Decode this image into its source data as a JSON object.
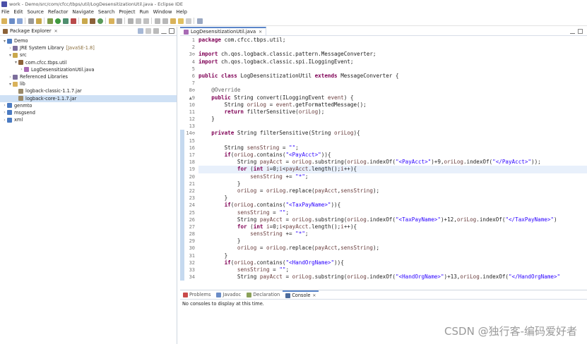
{
  "window": {
    "title": "work - Demo/src/com/cfcc/tbps/util/LogDesensitizationUtil.java - Eclipse IDE"
  },
  "menu": [
    "File",
    "Edit",
    "Source",
    "Refactor",
    "Navigate",
    "Search",
    "Project",
    "Run",
    "Window",
    "Help"
  ],
  "explorer": {
    "tab_label": "Package Explorer",
    "close": "✕",
    "tree": [
      {
        "label": "Demo",
        "indent": 0,
        "arrow": "▾",
        "icon": "project-icon",
        "color": "#4b7bc2"
      },
      {
        "label": "JRE System Library",
        "decor": "[JavaSE-1.8]",
        "indent": 1,
        "arrow": "›",
        "icon": "library-icon",
        "color": "#7c6e9c"
      },
      {
        "label": "src",
        "indent": 1,
        "arrow": "▾",
        "icon": "source-folder-icon",
        "color": "#c9a84c"
      },
      {
        "label": "com.cfcc.tbps.util",
        "indent": 2,
        "arrow": "▾",
        "icon": "package-icon",
        "color": "#8c6239"
      },
      {
        "label": "LogDesensitizationUtil.java",
        "indent": 3,
        "arrow": "›",
        "icon": "java-file-icon",
        "color": "#a86bb5"
      },
      {
        "label": "Referenced Libraries",
        "indent": 1,
        "arrow": "›",
        "icon": "library-icon",
        "color": "#7c6e9c"
      },
      {
        "label": "lib",
        "indent": 1,
        "arrow": "▾",
        "icon": "folder-icon",
        "color": "#d9b25a"
      },
      {
        "label": "logback-classic-1.1.7.jar",
        "indent": 2,
        "arrow": "",
        "icon": "jar-icon",
        "color": "#9a8a6a"
      },
      {
        "label": "logback-core-1.1.7.jar",
        "indent": 2,
        "arrow": "",
        "icon": "jar-icon",
        "color": "#9a8a6a",
        "selected": true
      },
      {
        "label": "genmto",
        "indent": 0,
        "arrow": "›",
        "icon": "project-icon",
        "color": "#4b7bc2"
      },
      {
        "label": "msgsend",
        "indent": 0,
        "arrow": "›",
        "icon": "project-icon",
        "color": "#4b7bc2"
      },
      {
        "label": "xml",
        "indent": 0,
        "arrow": "›",
        "icon": "project-icon",
        "color": "#4b7bc2"
      }
    ]
  },
  "editor": {
    "tab_label": "LogDesensitizationUtil.java",
    "close": "✕",
    "lines": [
      {
        "n": "1",
        "html": "<span class=\"kw\">package</span> com.cfcc.tbps.util;"
      },
      {
        "n": "2",
        "html": ""
      },
      {
        "n": "3⊖",
        "html": "<span class=\"kw\">import</span> ch.qos.logback.classic.pattern.MessageConverter;"
      },
      {
        "n": "4",
        "html": "<span class=\"kw\">import</span> ch.qos.logback.classic.spi.ILoggingEvent;"
      },
      {
        "n": "5",
        "html": ""
      },
      {
        "n": "6",
        "html": "<span class=\"kw\">public class</span> LogDesensitizationUtil <span class=\"kw\">extends</span> MessageConverter {"
      },
      {
        "n": "7",
        "html": ""
      },
      {
        "n": "8⊖",
        "html": "    <span class=\"ann\">@Override</span>"
      },
      {
        "n": "▲9",
        "html": "    <span class=\"kw\">public</span> String convert(ILoggingEvent <span class=\"var\">event</span>) {"
      },
      {
        "n": "10",
        "html": "        String <span class=\"var\">oriLog</span> = <span class=\"var\">event</span>.getFormattedMessage();"
      },
      {
        "n": "11",
        "html": "        <span class=\"kw\">return</span> filterSensitive(<span class=\"var\">oriLog</span>);"
      },
      {
        "n": "12",
        "html": "    }"
      },
      {
        "n": "13",
        "html": ""
      },
      {
        "n": "14⊖",
        "html": "    <span class=\"kw\">private</span> String filterSensitive(String <span class=\"var\">oriLog</span>){",
        "marked": true
      },
      {
        "n": "15",
        "html": "",
        "marked": true
      },
      {
        "n": "16",
        "html": "        String <span class=\"var\">sensString</span> = <span class=\"str\">\"\"</span>;",
        "marked": true
      },
      {
        "n": "17",
        "html": "        <span class=\"kw\">if</span>(<span class=\"var\">oriLog</span>.contains(<span class=\"str\">\"&lt;PayAcct&gt;\"</span>)){",
        "marked": true
      },
      {
        "n": "18",
        "html": "            String <span class=\"var\">payAcct</span> = <span class=\"var\">oriLog</span>.substring(<span class=\"var\">oriLog</span>.indexOf(<span class=\"str\">\"&lt;PayAcct&gt;\"</span>)+9,<span class=\"var\">oriLog</span>.indexOf(<span class=\"str\">\"&lt;/PayAcct&gt;\"</span>));",
        "marked": true
      },
      {
        "n": "19",
        "html": "            <span class=\"kw\">for</span> (<span class=\"kw\">int</span> <span class=\"var\">i</span>=0;<span class=\"var\">i</span>&lt;<span class=\"var\">payAcct</span>.length();<span class=\"var\">i</span>++){",
        "marked": true,
        "current": true
      },
      {
        "n": "20",
        "html": "                <span class=\"var\">sensString</span> += <span class=\"str\">\"*\"</span>;",
        "marked": true
      },
      {
        "n": "21",
        "html": "            }",
        "marked": true
      },
      {
        "n": "22",
        "html": "            <span class=\"var\">oriLog</span> = <span class=\"var\">oriLog</span>.replace(<span class=\"var\">payAcct</span>,<span class=\"var\">sensString</span>);",
        "marked": true
      },
      {
        "n": "23",
        "html": "        }",
        "marked": true
      },
      {
        "n": "24",
        "html": "        <span class=\"kw\">if</span>(<span class=\"var\">oriLog</span>.contains(<span class=\"str\">\"&lt;TaxPayName&gt;\"</span>)){",
        "marked": true
      },
      {
        "n": "25",
        "html": "            <span class=\"var\">sensString</span> = <span class=\"str\">\"\"</span>;",
        "marked": true
      },
      {
        "n": "26",
        "html": "            String <span class=\"var\">payAcct</span> = <span class=\"var\">oriLog</span>.substring(<span class=\"var\">oriLog</span>.indexOf(<span class=\"str\">\"&lt;TaxPayName&gt;\"</span>)+12,<span class=\"var\">oriLog</span>.indexOf(<span class=\"str\">\"&lt;/TaxPayName&gt;\"</span>)",
        "marked": true
      },
      {
        "n": "27",
        "html": "            <span class=\"kw\">for</span> (<span class=\"kw\">int</span> <span class=\"var\">i</span>=0;<span class=\"var\">i</span>&lt;<span class=\"var\">payAcct</span>.length();<span class=\"var\">i</span>++){",
        "marked": true
      },
      {
        "n": "28",
        "html": "                <span class=\"var\">sensString</span> += <span class=\"str\">\"*\"</span>;",
        "marked": true
      },
      {
        "n": "29",
        "html": "            }",
        "marked": true
      },
      {
        "n": "30",
        "html": "            <span class=\"var\">oriLog</span> = <span class=\"var\">oriLog</span>.replace(<span class=\"var\">payAcct</span>,<span class=\"var\">sensString</span>);",
        "marked": true
      },
      {
        "n": "31",
        "html": "        }",
        "marked": true
      },
      {
        "n": "32",
        "html": "        <span class=\"kw\">if</span>(<span class=\"var\">oriLog</span>.contains(<span class=\"str\">\"&lt;HandOrgName&gt;\"</span>)){",
        "marked": true
      },
      {
        "n": "33",
        "html": "            <span class=\"var\">sensString</span> = <span class=\"str\">\"\"</span>;",
        "marked": true
      },
      {
        "n": "34",
        "html": "            String <span class=\"var\">payAcct</span> = <span class=\"var\">oriLog</span>.substring(<span class=\"var\">oriLog</span>.indexOf(<span class=\"str\">\"&lt;HandOrgName&gt;\"</span>)+13,<span class=\"var\">oriLog</span>.indexOf(<span class=\"str\">\"&lt;/HandOrgName&gt;\"</span>",
        "marked": true
      }
    ]
  },
  "bottom": {
    "tabs": [
      {
        "label": "Problems",
        "icon": "problems-icon",
        "color": "#c94a4a"
      },
      {
        "label": "Javadoc",
        "icon": "javadoc-icon",
        "color": "#6a8cc7"
      },
      {
        "label": "Declaration",
        "icon": "declaration-icon",
        "color": "#8aa15a"
      },
      {
        "label": "Console",
        "icon": "console-icon",
        "color": "#4b6b9c",
        "active": true
      }
    ],
    "close": "✕",
    "message": "No consoles to display at this time."
  },
  "watermark": "CSDN @独行客-编码爱好者",
  "colors": {
    "keyword": "#7f0055",
    "string": "#2a00ff",
    "variable": "#6a3e3e",
    "annotation": "#646464",
    "selection": "#cfe1f5",
    "current_line": "#e8f0fb"
  }
}
